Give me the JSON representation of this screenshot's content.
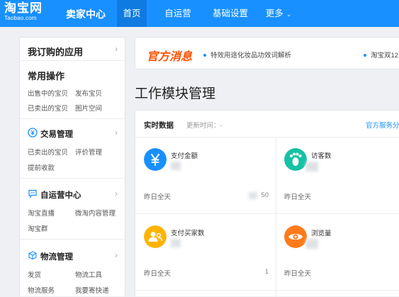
{
  "header": {
    "logo_main": "淘宝网",
    "logo_sub": "Taobao.com",
    "title": "卖家中心",
    "tabs": [
      {
        "label": "首页",
        "active": true
      },
      {
        "label": "自运营",
        "active": false
      },
      {
        "label": "基础设置",
        "active": false
      },
      {
        "label": "更多",
        "active": false
      }
    ],
    "more_chevron": "⌄",
    "brand_color": "#1890ff"
  },
  "sidebar": {
    "my_apps": "我订购的应用",
    "arrow": "›",
    "common_ops": {
      "title": "常用操作",
      "links": [
        "出售中的宝贝",
        "发布宝贝",
        "已卖出的宝贝",
        "图片空间"
      ]
    },
    "sections": [
      {
        "title": "交易管理",
        "icon": "yen-circle-icon",
        "links": [
          "已卖出的宝贝",
          "评价管理",
          "提前收款"
        ]
      },
      {
        "title": "自运营中心",
        "icon": "chat-bubble-icon",
        "links": [
          "淘宝直播",
          "微淘内容管理",
          "淘宝群"
        ]
      },
      {
        "title": "物流管理",
        "icon": "box-icon",
        "links": [
          "发货",
          "物流工具",
          "物流服务",
          "我要寄快递"
        ]
      }
    ]
  },
  "notice": {
    "tag": "官方消息",
    "items": [
      "特效用途化妆品功效词解析",
      "淘宝双12"
    ]
  },
  "main": {
    "title": "工作模块管理",
    "tab_realtime": "实时数据",
    "update_time": "更新时间：-",
    "service_link": "官方服务分",
    "metrics": [
      {
        "label": "支付金额",
        "icon": "yen-icon",
        "color": "#1890ff",
        "yesterday_label": "昨日全天",
        "yesterday_value": "50"
      },
      {
        "label": "访客数",
        "icon": "footprint-icon",
        "color": "#16c1a4",
        "yesterday_label": "昨日全天",
        "yesterday_value": ""
      },
      {
        "label": "支付买家数",
        "icon": "buyer-icon",
        "color": "#ffb300",
        "yesterday_label": "昨日全天",
        "yesterday_value": "1"
      },
      {
        "label": "浏览量",
        "icon": "eye-icon",
        "color": "#ff7a1a",
        "yesterday_label": "昨日全天",
        "yesterday_value": ""
      }
    ]
  }
}
